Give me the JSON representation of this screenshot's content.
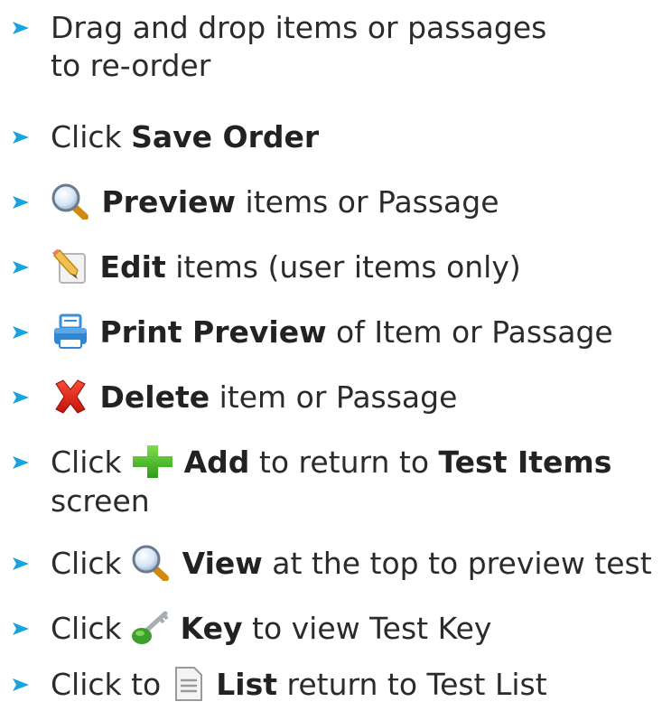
{
  "colors": {
    "arrow": "#1ba3e0",
    "text": "#2b2b2b"
  },
  "bullets": [
    {
      "line1": "Drag and drop items or passages",
      "line2": "to re-order"
    },
    {
      "pre": "Click ",
      "bold": "Save Order"
    },
    {
      "icon": "magnifier-icon",
      "bold": "Preview",
      "post": " items or Passage"
    },
    {
      "icon": "edit-pencil-icon",
      "bold": "Edit",
      "post": " items (user items only)"
    },
    {
      "icon": "printer-icon",
      "bold": "Print Preview",
      "post": " of Item or Passage"
    },
    {
      "icon": "red-x-icon",
      "bold": "Delete",
      "post": " item or Passage"
    },
    {
      "pre": "Click ",
      "icon": "green-plus-icon",
      "bold": "Add",
      "mid": " to return to ",
      "bold2": "Test Items",
      "line2": "screen"
    },
    {
      "pre": "Click ",
      "icon": "magnifier-icon",
      "bold": "View",
      "post": " at the top to preview test"
    },
    {
      "pre": "Click ",
      "icon": "key-icon",
      "bold": "Key",
      "post": " to view Test Key"
    },
    {
      "pre": "Click to ",
      "icon": "document-icon",
      "bold": "List",
      "post": " return to Test List"
    }
  ]
}
